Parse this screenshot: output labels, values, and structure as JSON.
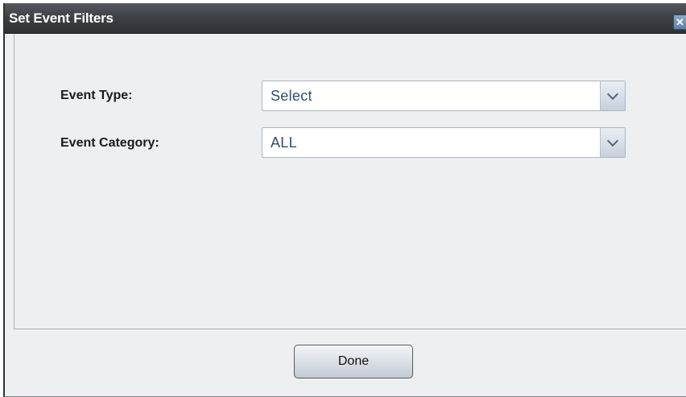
{
  "dialog": {
    "title": "Set Event Filters",
    "close_glyph": "✕"
  },
  "fields": [
    {
      "label": "Event Type:",
      "value": "Select"
    },
    {
      "label": "Event Category:",
      "value": "ALL"
    }
  ],
  "footer": {
    "done_label": "Done"
  },
  "icons": {
    "close": "close-icon",
    "dropdown": "chevron-down-icon"
  },
  "colors": {
    "title_bar": "#3e4246",
    "dialog_background": "#edeff1",
    "select_text": "#324e72"
  }
}
